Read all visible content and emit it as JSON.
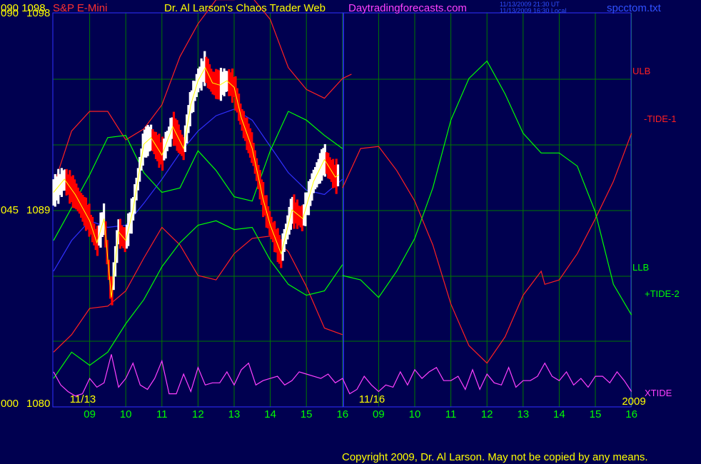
{
  "header": {
    "y_axis_top": "090  1098",
    "symbol": "S&P E-Mini",
    "title": "Dr. Al Larson's Chaos Trader Web",
    "site": "Daytradingforecasts.com",
    "stamp_ut": "11/13/2009 21:30 UT",
    "stamp_local": "11/13/2009 16:30 Local",
    "file": "spcctom.txt"
  },
  "footer": {
    "copyright": "Copyright 2009, Dr. Al Larson. May not be copied by any means."
  },
  "colors": {
    "background": "#000050",
    "grid": "#007800",
    "price_up": "#ffffff",
    "price_down": "#ff0000"
  },
  "chart_data": {
    "type": "line",
    "y_ticks": [
      {
        "left": "090",
        "price": "1098"
      },
      {
        "left": "045",
        "price": "1089"
      },
      {
        "left": "000",
        "price": "1080"
      }
    ],
    "ylim": [
      1080,
      1098
    ],
    "date_labels": [
      "11/13",
      "11/16",
      "2009"
    ],
    "x_tick_labels": [
      "09",
      "10",
      "11",
      "12",
      "13",
      "14",
      "15",
      "16",
      "09",
      "10",
      "11",
      "12",
      "13",
      "14",
      "15",
      "16"
    ],
    "legend": [
      {
        "name": "ULB",
        "color": "#ff2020"
      },
      {
        "name": "-TIDE-1",
        "color": "#ff2020"
      },
      {
        "name": "LLB",
        "color": "#00ff00"
      },
      {
        "name": "+TIDE-2",
        "color": "#00ff00"
      },
      {
        "name": "XTIDE",
        "color": "#ff40ff"
      }
    ],
    "series": [
      {
        "name": "price",
        "color": "#ffffff",
        "x": [
          0,
          0.3,
          0.6,
          1.0,
          1.2,
          1.4,
          1.6,
          1.8,
          2.0,
          2.2,
          2.5,
          2.7,
          3.0,
          3.3,
          3.6,
          3.8,
          4.0,
          4.2,
          4.4,
          4.6,
          4.8,
          5.0,
          5.2,
          5.5,
          5.8,
          6.0,
          6.3,
          6.6,
          6.9,
          7.2,
          7.5,
          7.8,
          7.9
        ],
        "values": [
          1089.8,
          1090.4,
          1089.7,
          1088.5,
          1087.5,
          1088.6,
          1085.0,
          1088.0,
          1087.6,
          1089.0,
          1092.0,
          1092.3,
          1091.5,
          1092.8,
          1091.8,
          1093.8,
          1094.9,
          1095.5,
          1094.8,
          1094.7,
          1094.9,
          1094.6,
          1093.2,
          1091.8,
          1089.5,
          1088.3,
          1087.0,
          1089.0,
          1088.6,
          1090.3,
          1091.3,
          1090.5,
          1090.6
        ]
      },
      {
        "name": "average",
        "color": "#3030ff",
        "x": [
          0,
          0.5,
          1.0,
          1.5,
          2.0,
          2.5,
          3.0,
          3.5,
          4.0,
          4.5,
          5.0,
          5.5,
          6.0,
          6.5,
          7.0,
          7.5,
          8.0
        ],
        "values": [
          1086.2,
          1087.6,
          1088.5,
          1088.2,
          1088.3,
          1089.3,
          1090.4,
          1091.6,
          1092.6,
          1093.3,
          1093.6,
          1093.1,
          1091.9,
          1090.7,
          1089.9,
          1089.7,
          1090.4
        ]
      },
      {
        "name": "ULB",
        "color": "#ff2020",
        "x": [
          0,
          0.5,
          1.0,
          1.5,
          2.0,
          2.5,
          3.0,
          3.5,
          4.0,
          4.5,
          5.0,
          5.5,
          6.0,
          6.5,
          7.0,
          7.5,
          8.0,
          8.25
        ],
        "values": [
          1090.1,
          1092.6,
          1093.5,
          1093.5,
          1092.2,
          1092.7,
          1093.8,
          1096.0,
          1097.5,
          1098.6,
          1098.6,
          1098.7,
          1097.7,
          1095.5,
          1094.5,
          1094.1,
          1095.0,
          1095.2
        ]
      },
      {
        "name": "mid",
        "color": "#ff2020",
        "x": [
          0,
          0.5,
          1.0,
          1.5,
          2.0,
          2.5,
          3.0,
          3.5,
          4.0,
          4.5,
          5.0,
          5.5,
          6.0,
          6.5,
          7.0,
          7.5,
          8.0
        ],
        "values": [
          1082.5,
          1083.3,
          1084.5,
          1084.6,
          1085.3,
          1086.8,
          1088.2,
          1087.4,
          1086.0,
          1085.8,
          1087.0,
          1087.7,
          1087.8,
          1087.1,
          1085.5,
          1083.6,
          1083.3
        ]
      },
      {
        "name": "LLB",
        "color": "#00ff00",
        "x": [
          0,
          0.5,
          1.0,
          1.5,
          2.0,
          2.5,
          3.0,
          3.5,
          4.0,
          4.5,
          5.0,
          5.5,
          6.0,
          6.5,
          7.0,
          7.5,
          8.0
        ],
        "values": [
          1081.3,
          1082.5,
          1081.9,
          1082.5,
          1083.8,
          1084.9,
          1086.4,
          1087.5,
          1088.3,
          1088.5,
          1088.1,
          1088.2,
          1086.7,
          1085.6,
          1085.1,
          1085.3,
          1086.5
        ]
      },
      {
        "name": "upper-green",
        "color": "#00ff00",
        "x": [
          0,
          0.5,
          1.0,
          1.5,
          2.0,
          2.5,
          3.0,
          3.5,
          4.0,
          4.5,
          5.0,
          5.5,
          6.0,
          6.5,
          7.0,
          7.5,
          8.0
        ],
        "values": [
          1087.6,
          1089.1,
          1090.6,
          1092.3,
          1092.4,
          1090.7,
          1089.8,
          1090.0,
          1091.7,
          1090.8,
          1089.6,
          1089.4,
          1091.7,
          1093.5,
          1093.1,
          1092.4,
          1091.8
        ]
      },
      {
        "name": "-TIDE-1",
        "color": "#ff2020",
        "x": [
          8.0,
          8.5,
          9.0,
          9.5,
          10.0,
          10.5,
          11.0,
          11.5,
          12.0,
          12.5,
          13.0,
          13.5,
          13.6,
          14.0,
          14.5,
          15.0,
          15.5,
          16.0
        ],
        "values": [
          1090.0,
          1091.8,
          1091.9,
          1090.8,
          1089.4,
          1087.4,
          1084.7,
          1082.8,
          1082.0,
          1083.2,
          1085.1,
          1086.2,
          1085.6,
          1085.8,
          1087.0,
          1088.6,
          1090.3,
          1092.5
        ]
      },
      {
        "name": "+TIDE-2",
        "color": "#00ff00",
        "x": [
          8.0,
          8.5,
          9.0,
          9.5,
          10.0,
          10.5,
          11.0,
          11.5,
          12.0,
          12.5,
          13.0,
          13.5,
          13.6,
          14.0,
          14.5,
          15.0,
          15.5,
          16.0
        ],
        "values": [
          1086.0,
          1085.8,
          1085.0,
          1086.2,
          1087.7,
          1090.0,
          1093.1,
          1095.0,
          1095.8,
          1094.3,
          1092.5,
          1091.6,
          1091.6,
          1091.6,
          1091.0,
          1088.9,
          1085.6,
          1084.2
        ]
      },
      {
        "name": "XTIDE",
        "color": "#ff40ff",
        "x": [
          0,
          0.2,
          0.4,
          0.6,
          0.8,
          1.0,
          1.2,
          1.4,
          1.6,
          1.8,
          2.0,
          2.2,
          2.4,
          2.6,
          2.8,
          3.0,
          3.2,
          3.4,
          3.6,
          3.8,
          4.0,
          4.2,
          4.4,
          4.6,
          4.8,
          5.0,
          5.2,
          5.4,
          5.6,
          5.8,
          6.0,
          6.2,
          6.4,
          6.6,
          6.8,
          7.0,
          7.2,
          7.4,
          7.6,
          7.8,
          8.0,
          8.2,
          8.4,
          8.6,
          8.8,
          9.0,
          9.2,
          9.4,
          9.6,
          9.8,
          10.0,
          10.2,
          10.4,
          10.6,
          10.8,
          11.0,
          11.2,
          11.4,
          11.6,
          11.8,
          12.0,
          12.2,
          12.4,
          12.6,
          12.8,
          13.0,
          13.2,
          13.4,
          13.6,
          13.8,
          14.0,
          14.2,
          14.4,
          14.6,
          14.8,
          15.0,
          15.2,
          15.4,
          15.6,
          15.8,
          16.0
        ],
        "values": [
          1081.6,
          1081.0,
          1080.7,
          1080.5,
          1080.6,
          1081.3,
          1080.9,
          1081.1,
          1082.4,
          1080.9,
          1081.3,
          1082.0,
          1081.0,
          1080.8,
          1081.3,
          1082.1,
          1080.6,
          1080.6,
          1081.5,
          1080.7,
          1081.8,
          1081.0,
          1081.1,
          1081.1,
          1081.6,
          1081.0,
          1081.7,
          1082.0,
          1081.0,
          1081.2,
          1081.3,
          1081.4,
          1081.0,
          1081.2,
          1081.6,
          1081.5,
          1081.4,
          1081.3,
          1081.5,
          1081.1,
          1081.3,
          1080.6,
          1080.8,
          1081.4,
          1081.0,
          1080.7,
          1081.0,
          1080.9,
          1081.6,
          1081.0,
          1081.7,
          1081.3,
          1081.6,
          1081.8,
          1081.2,
          1081.2,
          1081.4,
          1080.8,
          1081.7,
          1080.8,
          1081.5,
          1081.1,
          1081.0,
          1081.8,
          1080.9,
          1081.2,
          1081.2,
          1081.4,
          1082.0,
          1081.4,
          1081.2,
          1081.6,
          1081.0,
          1081.3,
          1080.9,
          1081.4,
          1081.4,
          1081.1,
          1081.6,
          1081.2,
          1080.7
        ]
      }
    ]
  }
}
